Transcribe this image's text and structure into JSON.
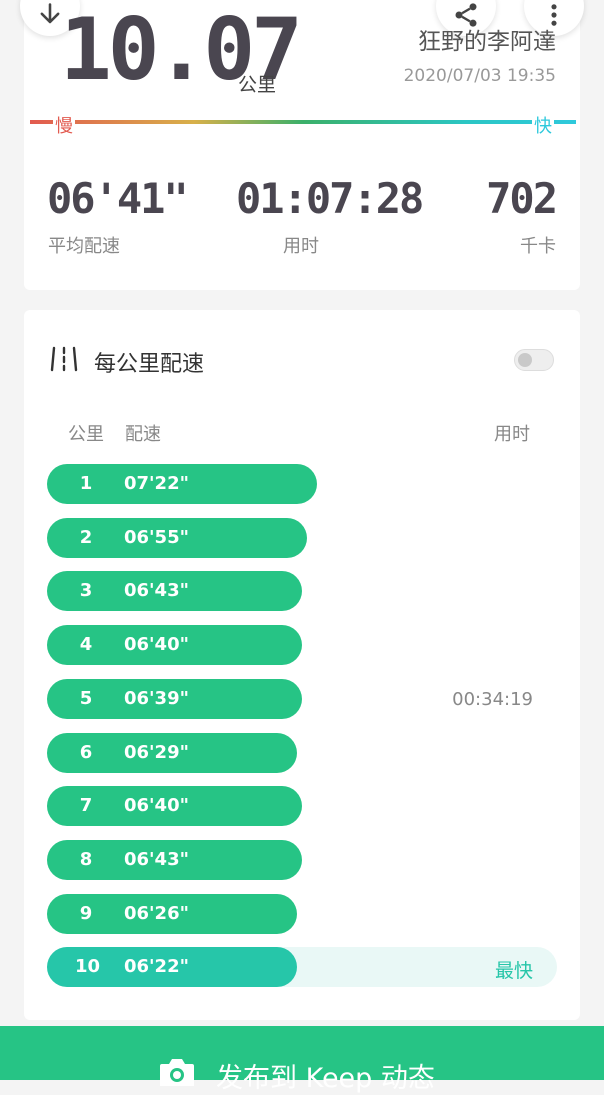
{
  "summary": {
    "distance": "10.07",
    "distance_unit": "公里",
    "runner_name": "狂野的李阿達",
    "date": "2020/07/03 19:35",
    "speed_slow_label": "慢",
    "speed_fast_label": "快",
    "stats": [
      {
        "value": "06'41\"",
        "label": "平均配速"
      },
      {
        "value": "01:07:28",
        "label": "用时"
      },
      {
        "value": "702",
        "label": "千卡"
      }
    ]
  },
  "top_buttons": {
    "download_icon": "download-icon",
    "share_icon": "share-icon",
    "more_icon": "more-vertical-icon"
  },
  "splits": {
    "title": "每公里配速",
    "toggle_on": false,
    "col_km": "公里",
    "col_pace": "配速",
    "col_time": "用时",
    "rows": [
      {
        "km": "1",
        "pace": "07'22\"",
        "time": "",
        "badge": "",
        "bar_fraction": 0.53
      },
      {
        "km": "2",
        "pace": "06'55\"",
        "time": "",
        "badge": "",
        "bar_fraction": 0.51
      },
      {
        "km": "3",
        "pace": "06'43\"",
        "time": "",
        "badge": "",
        "bar_fraction": 0.5
      },
      {
        "km": "4",
        "pace": "06'40\"",
        "time": "",
        "badge": "",
        "bar_fraction": 0.5
      },
      {
        "km": "5",
        "pace": "06'39\"",
        "time": "00:34:19",
        "badge": "",
        "bar_fraction": 0.5
      },
      {
        "km": "6",
        "pace": "06'29\"",
        "time": "",
        "badge": "",
        "bar_fraction": 0.49
      },
      {
        "km": "7",
        "pace": "06'40\"",
        "time": "",
        "badge": "",
        "bar_fraction": 0.5
      },
      {
        "km": "8",
        "pace": "06'43\"",
        "time": "",
        "badge": "",
        "bar_fraction": 0.5
      },
      {
        "km": "9",
        "pace": "06'26\"",
        "time": "",
        "badge": "",
        "bar_fraction": 0.49
      },
      {
        "km": "10",
        "pace": "06'22\"",
        "time": "",
        "badge": "最快",
        "bar_fraction": 0.49
      }
    ]
  },
  "publish": {
    "label": "发布到 Keep 动态",
    "icon": "camera-icon"
  },
  "colors": {
    "accent": "#26c485",
    "fastest": "#26c6a9",
    "slow": "#e25a4f",
    "fast": "#2ec9dc"
  }
}
